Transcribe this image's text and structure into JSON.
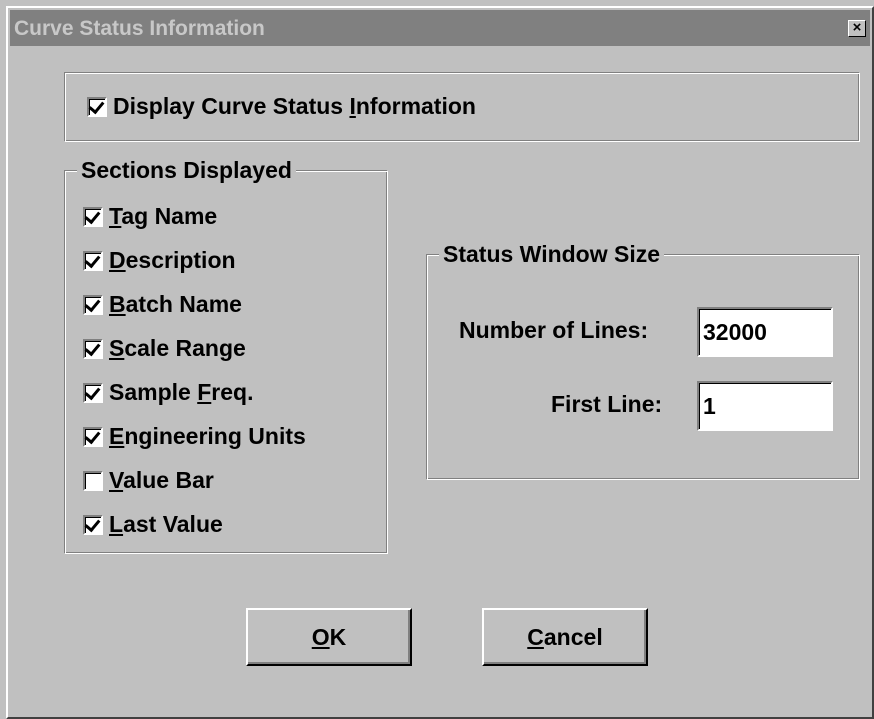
{
  "window": {
    "title": "Curve Status Information",
    "close_glyph": "×"
  },
  "display_checkbox": {
    "mnemonic_before": "Display Curve Status ",
    "mnemonic_char": "I",
    "mnemonic_after": "nformation",
    "checked": true
  },
  "sections": {
    "caption": "Sections Displayed",
    "items": [
      {
        "before": "",
        "u": "T",
        "after": "ag Name",
        "checked": true
      },
      {
        "before": "",
        "u": "D",
        "after": "escription",
        "checked": true
      },
      {
        "before": "",
        "u": "B",
        "after": "atch Name",
        "checked": true
      },
      {
        "before": "",
        "u": "S",
        "after": "cale Range",
        "checked": true
      },
      {
        "before": "Sample ",
        "u": "F",
        "after": "req.",
        "checked": true
      },
      {
        "before": "",
        "u": "E",
        "after": "ngineering Units",
        "checked": true
      },
      {
        "before": "",
        "u": "V",
        "after": "alue Bar",
        "checked": false
      },
      {
        "before": "",
        "u": "L",
        "after": "ast Value",
        "checked": true
      }
    ]
  },
  "status_window": {
    "caption": "Status Window Size",
    "number_of_lines_label": "Number of Lines:",
    "number_of_lines_value": "32000",
    "first_line_label": "First Line:",
    "first_line_value": "1"
  },
  "buttons": {
    "ok": {
      "u": "O",
      "after": "K"
    },
    "cancel": {
      "u": "C",
      "after": "ancel"
    }
  }
}
